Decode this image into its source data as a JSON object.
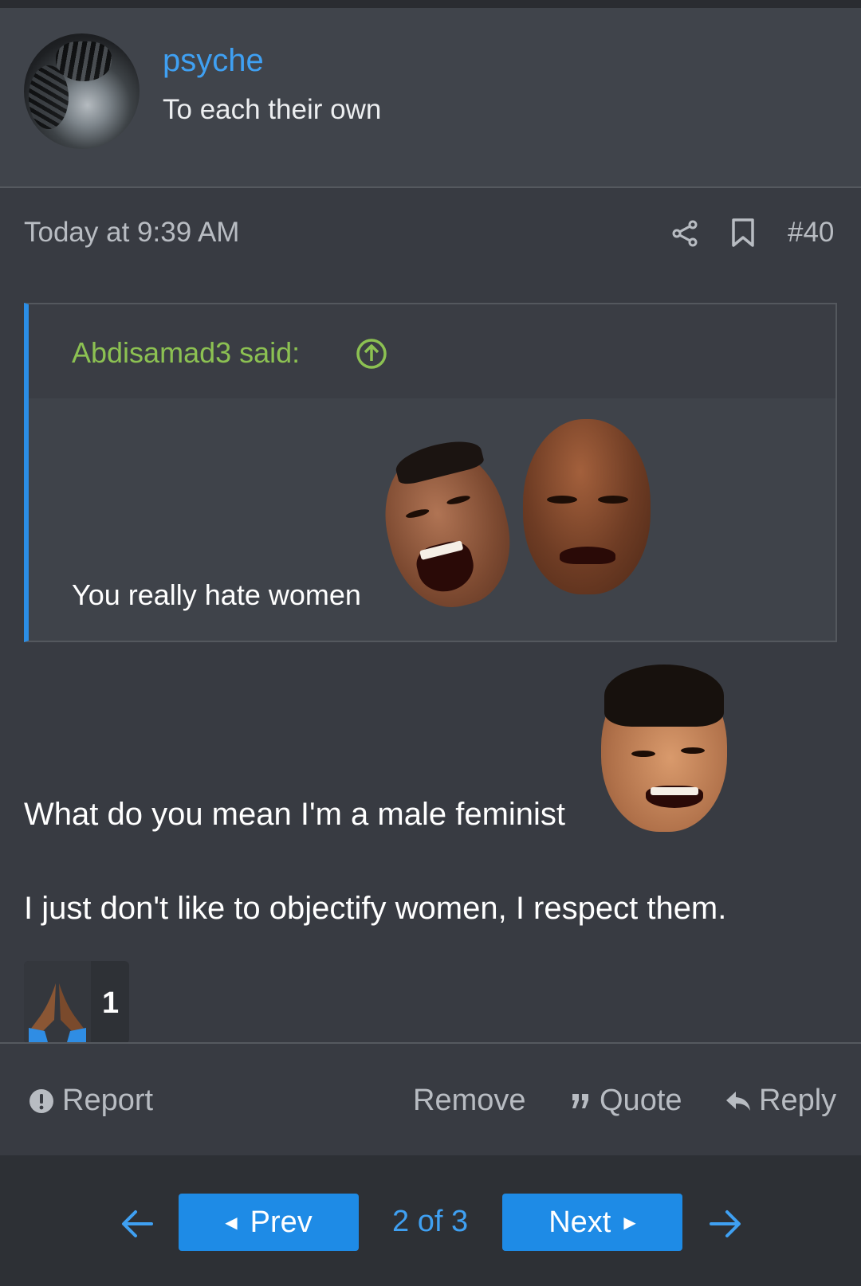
{
  "post": {
    "username": "psyche",
    "user_title": "To each their own",
    "date": "Today at 9:39 AM",
    "number": "#40",
    "quote": {
      "attribution": "Abdisamad3 said:",
      "text": "You really hate women"
    },
    "body_line1": "What do you mean I'm a male feminist",
    "body_line2": "I just don't like to objectify women, I respect them.",
    "reaction": {
      "emoji": "folded-hands",
      "count": "1"
    }
  },
  "actions": {
    "report": "Report",
    "remove": "Remove",
    "quote": "Quote",
    "reply": "Reply"
  },
  "pagination": {
    "prev_label": "Prev",
    "next_label": "Next",
    "page_indicator": "2 of 3"
  },
  "colors": {
    "accent_blue": "#3fa0f2",
    "button_blue": "#1e8be6",
    "quote_green": "#8cc152",
    "background": "#383b42"
  }
}
